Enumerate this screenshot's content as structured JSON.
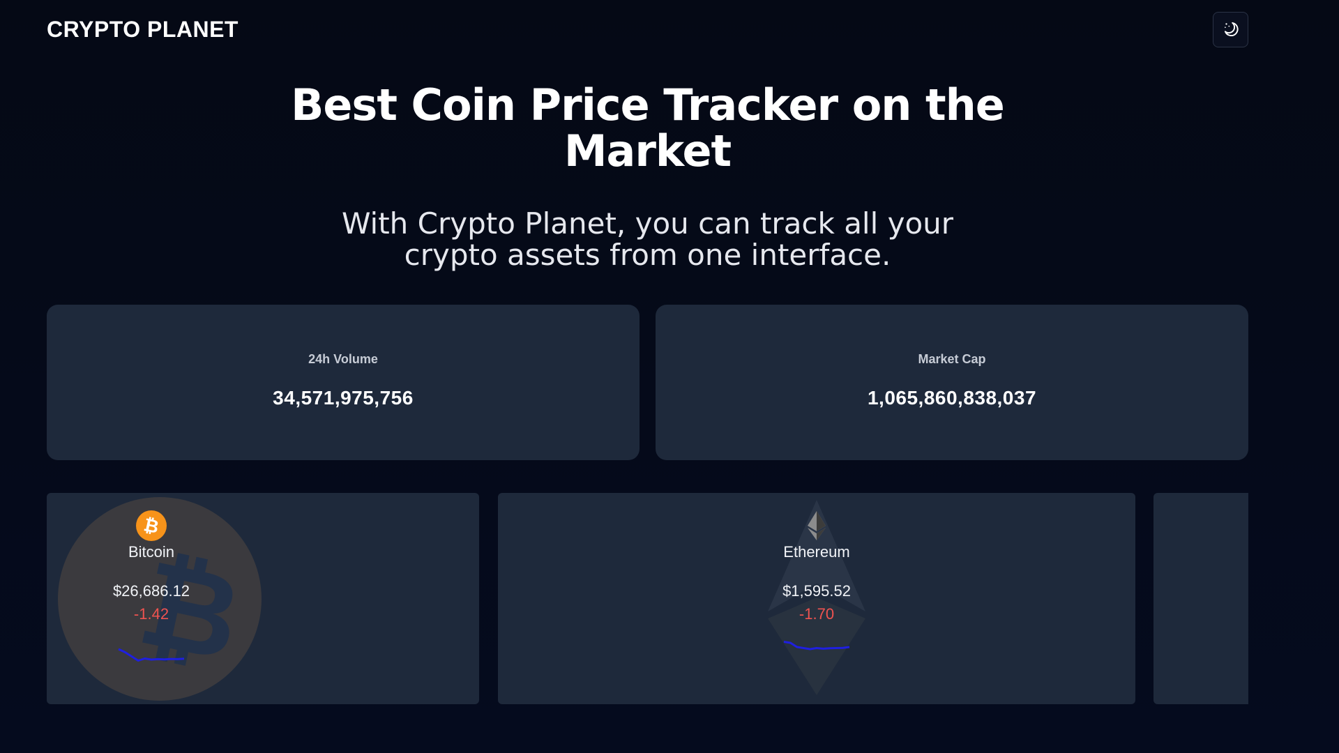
{
  "header": {
    "brand": "CRYPTO PLANET",
    "theme_toggle_icon": "moon-stars-icon"
  },
  "hero": {
    "title": "Best Coin Price Tracker on the Market",
    "subtitle": "With Crypto Planet, you can track all your crypto assets from one interface."
  },
  "stats": [
    {
      "label": "24h Volume",
      "value": "34,571,975,756"
    },
    {
      "label": "Market Cap",
      "value": "1,065,860,838,037"
    }
  ],
  "coins": [
    {
      "name": "Bitcoin",
      "price": "$26,686.12",
      "change": "-1.42",
      "icon": "bitcoin-logo-icon",
      "accent": "#f7931a",
      "sparkline_color": "#1f1fe0",
      "sparkline": [
        0.9,
        0.75,
        0.55,
        0.35,
        0.45,
        0.4,
        0.42,
        0.41,
        0.43,
        0.42,
        0.44
      ]
    },
    {
      "name": "Ethereum",
      "price": "$1,595.52",
      "change": "-1.70",
      "icon": "ethereum-logo-icon",
      "accent": "#8a8a8a",
      "sparkline_color": "#1f1fe0",
      "sparkline": [
        0.85,
        0.8,
        0.6,
        0.55,
        0.5,
        0.55,
        0.52,
        0.54,
        0.55,
        0.56,
        0.6
      ]
    }
  ],
  "colors": {
    "background": "#050a1a",
    "card": "#1e293b",
    "negative": "#ef5350"
  }
}
